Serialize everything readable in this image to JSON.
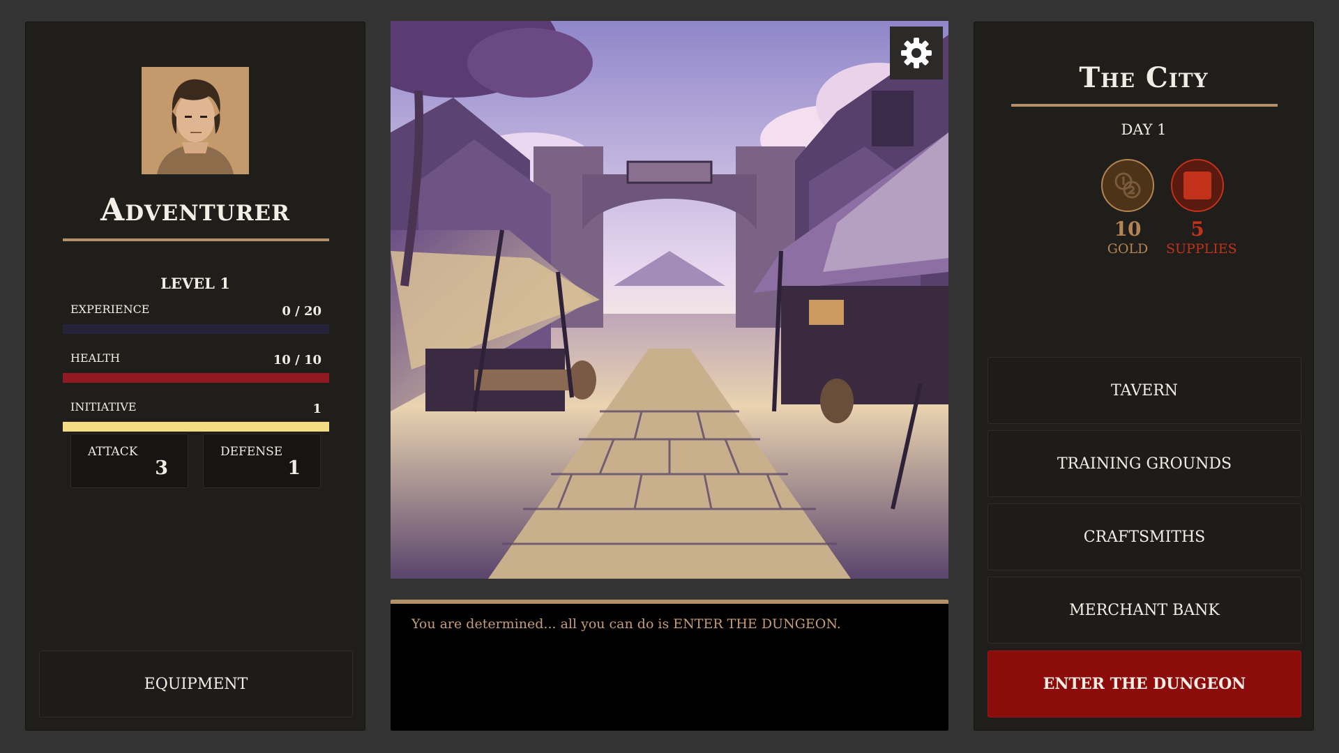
{
  "hero": {
    "name": "Adventurer",
    "level": "LEVEL 1",
    "stats": [
      {
        "label": "EXPERIENCE",
        "value": "0 / 20",
        "fill": 0.0,
        "track_color": "#25233a",
        "fill_color": "#5b4e9e"
      },
      {
        "label": "HEALTH",
        "value": "10 / 10",
        "fill": 1.0,
        "track_color": "#3b1014",
        "fill_color": "#8f1a22"
      },
      {
        "label": "INITIATIVE",
        "value": "1",
        "fill": 1.0,
        "track_color": "#3d3620",
        "fill_color": "#f2dc84"
      }
    ],
    "attack": {
      "label": "ATTACK",
      "value": "3"
    },
    "defense": {
      "label": "DEFENSE",
      "value": "1"
    },
    "equipment_label": "EQUIPMENT"
  },
  "scene": {
    "settings_icon": "gear-icon"
  },
  "log": {
    "message": "You are determined... all you can do is ENTER THE DUNGEON."
  },
  "city": {
    "title": "The City",
    "day": "DAY 1",
    "resources": [
      {
        "amount": "10",
        "label": "GOLD",
        "icon": "coins-icon",
        "color": "#b48552",
        "circle_bg": "#4d3418"
      },
      {
        "amount": "5",
        "label": "SUPPLIES",
        "icon": "supplies-icon",
        "color": "#c2321a",
        "circle_bg": "#5a1a10"
      }
    ],
    "locations": [
      "TAVERN",
      "TRAINING GROUNDS",
      "CRAFTSMITHS",
      "MERCHANT BANK"
    ],
    "dungeon_label": "ENTER THE DUNGEON"
  },
  "colors": {
    "accent_gold": "#b4906a",
    "dungeon_red": "#8c0c0c",
    "log_text": "#c79e73"
  }
}
